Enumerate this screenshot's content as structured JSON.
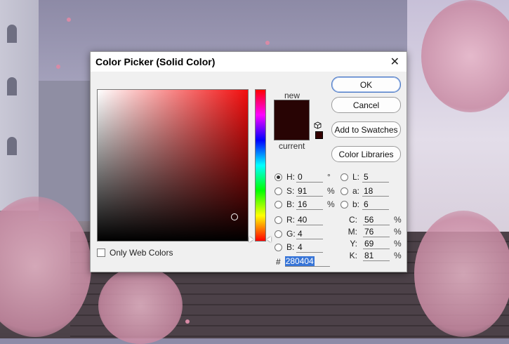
{
  "dialog": {
    "title": "Color Picker (Solid Color)",
    "close_glyph": "✕"
  },
  "preview": {
    "new_label": "new",
    "current_label": "current",
    "new_color": "#280404",
    "current_color": "#280404"
  },
  "buttons": {
    "ok": "OK",
    "cancel": "Cancel",
    "add_to_swatches": "Add to Swatches",
    "color_libraries": "Color Libraries"
  },
  "only_web_colors": {
    "label": "Only Web Colors",
    "checked": false
  },
  "hsb": {
    "h": {
      "label": "H:",
      "value": "0",
      "unit": "°",
      "selected": true
    },
    "s": {
      "label": "S:",
      "value": "91",
      "unit": "%"
    },
    "b": {
      "label": "B:",
      "value": "16",
      "unit": "%"
    }
  },
  "rgb": {
    "r": {
      "label": "R:",
      "value": "40"
    },
    "g": {
      "label": "G:",
      "value": "4"
    },
    "b": {
      "label": "B:",
      "value": "4"
    }
  },
  "lab": {
    "l": {
      "label": "L:",
      "value": "5"
    },
    "a": {
      "label": "a:",
      "value": "18"
    },
    "b": {
      "label": "b:",
      "value": "6"
    }
  },
  "cmyk": {
    "c": {
      "label": "C:",
      "value": "56",
      "unit": "%"
    },
    "m": {
      "label": "M:",
      "value": "76",
      "unit": "%"
    },
    "y": {
      "label": "Y:",
      "value": "69",
      "unit": "%"
    },
    "k": {
      "label": "K:",
      "value": "81",
      "unit": "%"
    }
  },
  "hex": {
    "label": "#",
    "value": "280404"
  },
  "colors": {
    "accent": "#3875d7",
    "field_hue": "#f20d0d"
  }
}
